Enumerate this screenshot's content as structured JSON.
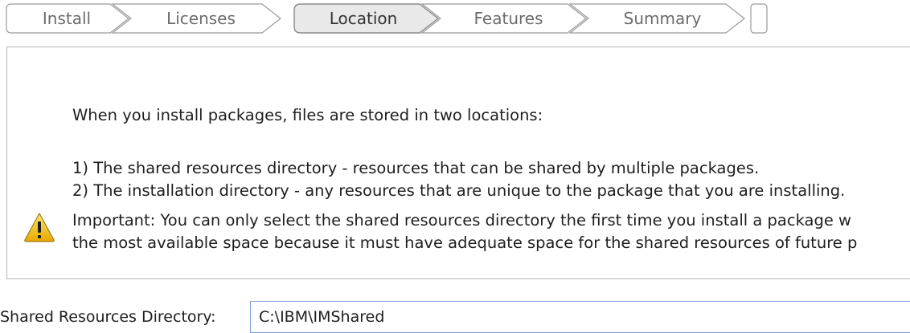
{
  "wizard": {
    "steps": [
      {
        "label": "Install"
      },
      {
        "label": "Licenses"
      },
      {
        "label": "Location",
        "active": true
      },
      {
        "label": "Features"
      },
      {
        "label": "Summary"
      },
      {
        "label": ""
      }
    ]
  },
  "info": {
    "icon": "warning-icon",
    "line_intro": "When you install packages, files are stored in two locations:",
    "line_shared": "1) The shared resources directory - resources that can be shared by multiple packages.",
    "line_install": "2) The installation directory - any resources that are unique to the package that you are installing.",
    "line_important_1": "Important: You can only select the shared resources directory the first time you install a package w",
    "line_important_2": "the most available space because it must have adequate space for the shared resources of future p"
  },
  "shared_dir": {
    "label": "Shared Resources Directory:",
    "value": "C:\\IBM\\IMShared"
  },
  "colors": {
    "step_border": "#9a9a9a",
    "active_step_fill": "#e9e9e9",
    "panel_border": "#b4b4b4",
    "input_border": "#7a9cd3",
    "warning_fill": "#f5c518"
  }
}
